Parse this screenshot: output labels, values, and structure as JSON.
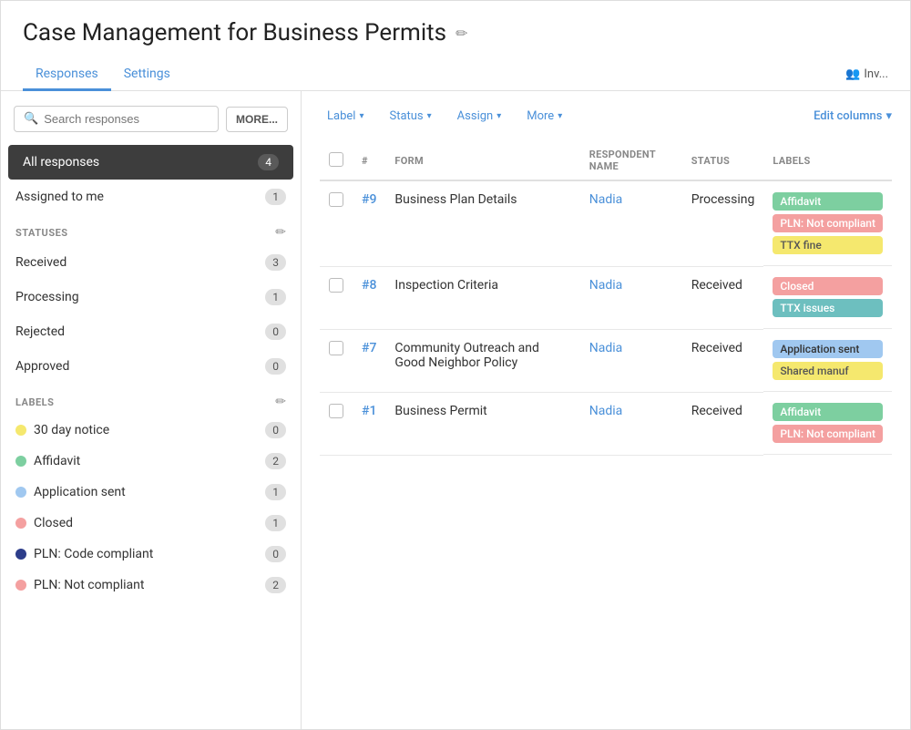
{
  "header": {
    "title": "Case Management for Business Permits",
    "edit_icon": "✏",
    "tabs": [
      {
        "label": "Responses",
        "active": true
      },
      {
        "label": "Settings",
        "active": false
      }
    ],
    "invite_label": "Inv..."
  },
  "sidebar": {
    "search_placeholder": "Search responses",
    "more_button": "MORE...",
    "all_responses": {
      "label": "All responses",
      "count": 4
    },
    "assigned_to_me": {
      "label": "Assigned to me",
      "count": 1
    },
    "statuses_section": "STATUSES",
    "statuses": [
      {
        "label": "Received",
        "count": 3
      },
      {
        "label": "Processing",
        "count": 1
      },
      {
        "label": "Rejected",
        "count": 0
      },
      {
        "label": "Approved",
        "count": 0
      }
    ],
    "labels_section": "LABELS",
    "labels": [
      {
        "label": "30 day notice",
        "count": 0,
        "color": "#f5e86e",
        "tag": "yellow"
      },
      {
        "label": "Affidavit",
        "count": 2,
        "color": "#7dcfa0",
        "tag": "green"
      },
      {
        "label": "Application sent",
        "count": 1,
        "color": "#a0c8f0",
        "tag": "blue"
      },
      {
        "label": "Closed",
        "count": 1,
        "color": "#f4a0a0",
        "tag": "pink"
      },
      {
        "label": "PLN: Code compliant",
        "count": 0,
        "color": "#2d3d8a",
        "tag": "darkblue"
      },
      {
        "label": "PLN: Not compliant",
        "count": 2,
        "color": "#f4a0a0",
        "tag": "pink"
      }
    ]
  },
  "toolbar": {
    "label_btn": "Label",
    "status_btn": "Status",
    "assign_btn": "Assign",
    "more_btn": "More",
    "edit_columns_btn": "Edit columns"
  },
  "table": {
    "columns": [
      "#",
      "FORM",
      "RESPONDENT NAME",
      "STATUS",
      "LABELS"
    ],
    "rows": [
      {
        "num": "#9",
        "form": "Business Plan Details",
        "respondent": "Nadia",
        "status": "Processing",
        "labels": [
          {
            "text": "Affidavit",
            "tag": "green"
          },
          {
            "text": "PLN: Not compliant",
            "tag": "pink"
          },
          {
            "text": "TTX fine",
            "tag": "yellow"
          }
        ]
      },
      {
        "num": "#8",
        "form": "Inspection Criteria",
        "respondent": "Nadia",
        "status": "Received",
        "labels": [
          {
            "text": "Closed",
            "tag": "pink"
          },
          {
            "text": "TTX issues",
            "tag": "teal"
          }
        ]
      },
      {
        "num": "#7",
        "form": "Community Outreach and Good Neighbor Policy",
        "respondent": "Nadia",
        "status": "Received",
        "labels": [
          {
            "text": "Application sent",
            "tag": "blue"
          },
          {
            "text": "Shared manuf",
            "tag": "yellow"
          }
        ]
      },
      {
        "num": "#1",
        "form": "Business Permit",
        "respondent": "Nadia",
        "status": "Received",
        "labels": [
          {
            "text": "Affidavit",
            "tag": "green"
          },
          {
            "text": "PLN: Not compliant",
            "tag": "pink"
          }
        ]
      }
    ]
  }
}
